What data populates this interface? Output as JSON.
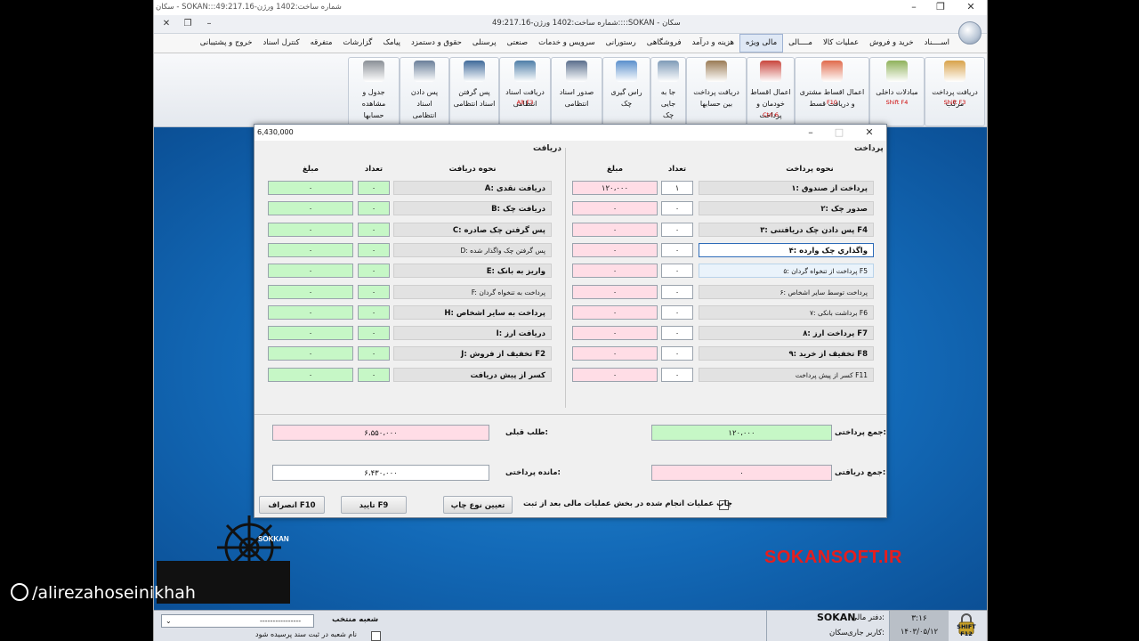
{
  "window": {
    "title": "سکان - SOKAN:::شماره ساخت:1402 ورژن-49:217.16",
    "title2": "شماره ساخت:1402 ورژن-49:217.16::::SOKAN - سکان"
  },
  "menu": [
    "اســــناد",
    "خرید و فروش",
    "عملیات کالا",
    "مــــالی",
    "مالی ویژه",
    "هزینه و درآمد",
    "فروشگاهی",
    "رستورانی",
    "سرویس و خدمات",
    "صنعتی",
    "پرسنلی",
    "حقوق و دستمزد",
    "پیامک",
    "گزارشات",
    "متفرقه",
    "کنترل اسناد",
    "خروج و پشتیبانی"
  ],
  "ribbon": [
    {
      "label": "دریافت پرداخت\nمرکب",
      "shortcut": "Shift F3"
    },
    {
      "label": "مبادلات داخلی",
      "shortcut": "Shift F4"
    },
    {
      "label": "اعمال اقساط مشتری\nو دریافت قسط",
      "shortcut": "F10"
    },
    {
      "label": "اعمال اقساط\nخودمان و پرداخت\nقسط",
      "shortcut": "Ctrl 6"
    },
    {
      "label": "دریافت پرداخت\nبین حسابها",
      "shortcut": ""
    },
    {
      "label": "جا به جایی\nچک",
      "shortcut": ""
    },
    {
      "label": "راس گیری\nچک",
      "shortcut": ""
    },
    {
      "label": "صدور اسناد\nانتظامی",
      "shortcut": ""
    },
    {
      "label": "دریافت اسناد\nانتظامی",
      "shortcut": "Alt F3"
    },
    {
      "label": "پس گرفتن\nاسناد انتظامی",
      "shortcut": ""
    },
    {
      "label": "پس دادن اسناد\nانتظامی",
      "shortcut": ""
    },
    {
      "label": "جدول و مشاهده\nحسابها",
      "shortcut": ""
    }
  ],
  "dialog": {
    "title_value": "6,430,000",
    "payment_section": "پرداخت",
    "receipt_section": "دریافت",
    "col_method_pay": "نحوه پرداخت",
    "col_method_recv": "نحوه دریافت",
    "col_count": "تعداد",
    "col_amount": "مبلغ",
    "payments": [
      {
        "label": "۱: پرداخت از صندوق",
        "count": "۱",
        "amount": "۱۲۰،۰۰۰"
      },
      {
        "label": "۲: صدور چک",
        "count": "۰",
        "amount": "۰"
      },
      {
        "label": "۳: پس دادن چک دریافتنی F4",
        "count": "۰",
        "amount": "۰"
      },
      {
        "label": "۴: واگذاري چک وارده",
        "count": "۰",
        "amount": "۰"
      },
      {
        "label": "۵: پرداخت از تنخواه گردان F5",
        "count": "۰",
        "amount": "۰"
      },
      {
        "label": "۶: پرداخت توسط سایر اشخاص",
        "count": "۰",
        "amount": "۰"
      },
      {
        "label": "۷: برداشت بانکی F6",
        "count": "۰",
        "amount": "۰"
      },
      {
        "label": "۸: پرداخت ارز F7",
        "count": "۰",
        "amount": "۰"
      },
      {
        "label": "۹: تخفیف از خرید F8",
        "count": "۰",
        "amount": "۰"
      },
      {
        "label": "کسر از پیش پرداخت F11",
        "count": "۰",
        "amount": "۰"
      }
    ],
    "receipts": [
      {
        "label": "A: دریافت نقدی",
        "count": "۰",
        "amount": "۰"
      },
      {
        "label": "B: دریافت چک",
        "count": "۰",
        "amount": "۰"
      },
      {
        "label": "C: پس گرفتن چک صادره",
        "count": "۰",
        "amount": "۰"
      },
      {
        "label": "D: پس گرفتن چک واگذار شده",
        "count": "۰",
        "amount": "۰"
      },
      {
        "label": "E: واریز به بانک",
        "count": "۰",
        "amount": "۰"
      },
      {
        "label": "F: پرداخت به تنخواه گردان",
        "count": "۰",
        "amount": "۰"
      },
      {
        "label": "H: پرداخت به سایر اشخاص",
        "count": "۰",
        "amount": "۰"
      },
      {
        "label": "I: دریافت ارز",
        "count": "۰",
        "amount": "۰"
      },
      {
        "label": "J: تخفیف از فروش F2",
        "count": "۰",
        "amount": "۰"
      },
      {
        "label": "کسر از پیش دریافت",
        "count": "۰",
        "amount": "۰"
      }
    ],
    "total_paid_label": "جمع پرداختی:",
    "total_paid": "۱۲۰،۰۰۰",
    "total_received_label": "جمع دریافتی:",
    "total_received": "۰",
    "prev_balance_label": "طلب قبلی:",
    "prev_balance": "۶،۵۵۰،۰۰۰",
    "remaining_label": "مانده پرداختی:",
    "remaining": "۶،۴۳۰،۰۰۰",
    "print_check_label": "چاپ عملیات انجام شده در بخش عملیات مالی بعد از ثبت",
    "print_type_btn": "تعیین نوع چاپ",
    "confirm_btn": "تایید F9",
    "cancel_btn": "انصراف F10"
  },
  "brand_text": "SOKANSOFT.IR",
  "status": {
    "branch_label": "شعبه منتخب",
    "branch_value": "----------------",
    "branch_check": "نام شعبه در ثبت سند پرسیده شود",
    "company_label": "دفتر مالی:",
    "company": "SOKAN",
    "user_label": "کاربر جاری:",
    "user": "سکان",
    "time": "۳:۱۶",
    "date": "۱۴۰۳/۰۵/۱۲",
    "shift_label": "SHIFT F12"
  },
  "watermark": "/alirezahoseinikhah",
  "logo_text": "SOKKAN",
  "colors": {
    "desktop": "#136ab8",
    "brand": "#e61e1e",
    "green_cell": "#c6f7c6",
    "pink_cell": "#ffdde6"
  }
}
